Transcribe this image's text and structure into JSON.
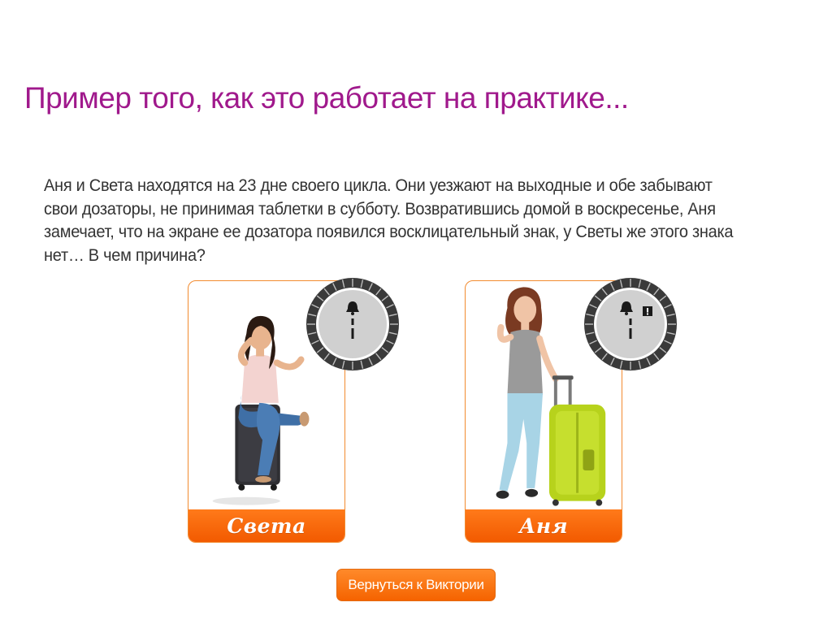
{
  "title": "Пример того, как это работает на практике...",
  "story": "Аня и Света находятся на 23 дне своего цикла. Они уезжают на выходные и обе забывают свои дозаторы, не принимая таблетки в субботу. Возвратившись домой в воскресенье, Аня замечает, что на экране ее дозатора появился восклицательный знак, у Светы же этого знака нет… В чем причина?",
  "cards": [
    {
      "name": "Света",
      "photo": "woman-sitting-on-suitcase",
      "dispenser": {
        "icons": [
          "bell-icon"
        ],
        "warning": false
      }
    },
    {
      "name": "Аня",
      "photo": "woman-standing-with-suitcase",
      "dispenser": {
        "icons": [
          "bell-icon",
          "exclamation-icon"
        ],
        "warning": true
      }
    }
  ],
  "back_button": {
    "label": "Вернуться к Виктории"
  },
  "colors": {
    "title": "#a0198c",
    "accent": "#f56300",
    "card_border": "#f28b30",
    "text": "#333333",
    "dispenser_ring": "#3a3a3a",
    "dispenser_face": "#d0d0d0"
  }
}
